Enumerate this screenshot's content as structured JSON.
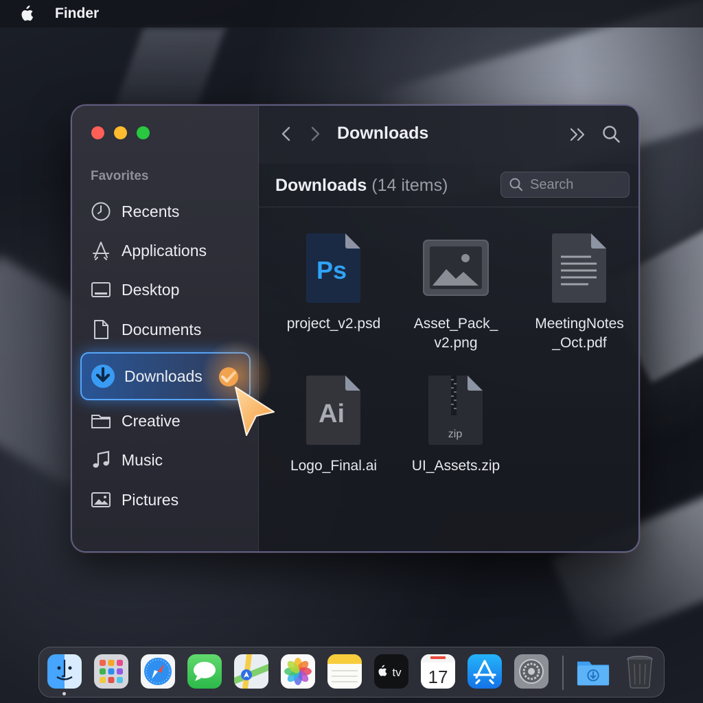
{
  "menubar": {
    "app_name": "Finder"
  },
  "window": {
    "title": "Downloads",
    "folder_label": "Downloads",
    "item_count": "(14 items)",
    "search_placeholder": "Search"
  },
  "sidebar": {
    "section": "Favorites",
    "items": [
      {
        "label": "Recents",
        "icon": "clock-icon"
      },
      {
        "label": "Applications",
        "icon": "applications-icon"
      },
      {
        "label": "Desktop",
        "icon": "desktop-icon"
      },
      {
        "label": "Documents",
        "icon": "document-icon"
      },
      {
        "label": "Downloads",
        "icon": "download-icon",
        "selected": true
      },
      {
        "label": "Creative",
        "icon": "folder-icon"
      },
      {
        "label": "Music",
        "icon": "music-note-icon"
      },
      {
        "label": "Pictures",
        "icon": "picture-icon"
      }
    ]
  },
  "files": [
    {
      "name": "project_v2.psd",
      "icon": "photoshop-file-icon",
      "glyph": "Ps"
    },
    {
      "name": "Asset_Pack_\nv2.png",
      "icon": "image-file-icon"
    },
    {
      "name": "MeetingNotes\n_Oct.pdf",
      "icon": "pdf-document-icon"
    },
    {
      "name": "Logo_Final.ai",
      "icon": "illustrator-file-icon",
      "glyph": "Ai"
    },
    {
      "name": "UI_Assets.zip",
      "icon": "zip-archive-icon",
      "glyph": "zip"
    }
  ],
  "dock": {
    "apps": [
      "finder",
      "launchpad",
      "safari",
      "messages",
      "maps",
      "photos",
      "notes",
      "apple-tv",
      "calendar",
      "app-store",
      "system-settings"
    ],
    "tv_label": "tv",
    "calendar_day": "17",
    "right": [
      "downloads-folder",
      "trash"
    ]
  },
  "colors": {
    "accent": "#3a9bf4",
    "cursor": "#f5a14a",
    "ps_blue": "#2fa3f7"
  }
}
